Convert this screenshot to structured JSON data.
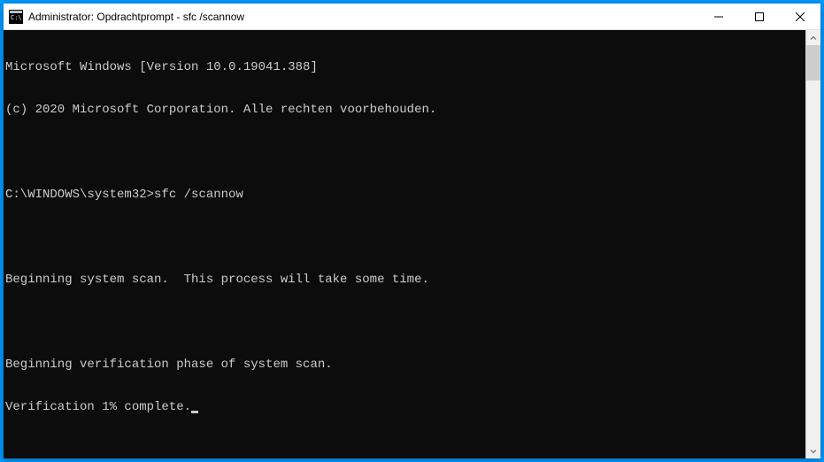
{
  "window": {
    "title": "Administrator: Opdrachtprompt - sfc  /scannow"
  },
  "terminal": {
    "line1": "Microsoft Windows [Version 10.0.19041.388]",
    "line2": "(c) 2020 Microsoft Corporation. Alle rechten voorbehouden.",
    "blank1": "",
    "prompt": "C:\\WINDOWS\\system32>",
    "command": "sfc /scannow",
    "blank2": "",
    "line3": "Beginning system scan.  This process will take some time.",
    "blank3": "",
    "line4": "Beginning verification phase of system scan.",
    "line5": "Verification 1% complete."
  }
}
